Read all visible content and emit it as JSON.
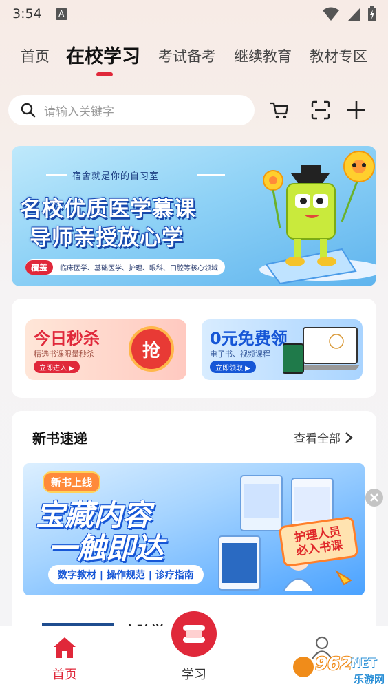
{
  "status_bar": {
    "time": "3:54",
    "indicator": "A"
  },
  "tabs": [
    {
      "label": "首页"
    },
    {
      "label": "在校学习"
    },
    {
      "label": "考试备考"
    },
    {
      "label": "继续教育"
    },
    {
      "label": "教材专区"
    }
  ],
  "active_tab_index": 1,
  "search": {
    "placeholder": "请输入关键字"
  },
  "top_icons": [
    "cart-icon",
    "scan-icon",
    "plus-icon"
  ],
  "banner": {
    "subtitle": "宿舍就是你的自习室",
    "headline_1": "名校优质医学慕课",
    "headline_2": "导师亲授放心学",
    "tag": "覆盖",
    "coverage": "临床医学、基础医学、护理、眼科、口腔等核心领域"
  },
  "promos": [
    {
      "title": "今日秒杀",
      "desc": "精选书课限量秒杀",
      "button": "立即进入 ▶",
      "badge": "抢"
    },
    {
      "title": "0元免费领",
      "desc": "电子书、视频课程",
      "button": "立即领取 ▶"
    }
  ],
  "new_books": {
    "title": "新书速递",
    "view_all": "查看全部",
    "banner": {
      "tag": "新书上线",
      "line1": "宝藏内容",
      "line2": "一触即达",
      "strip": "数字教材 | 操作规范 | 诊疗指南",
      "callout_1": "护理人员",
      "callout_2": "必入书课"
    },
    "peek_text": "实验学"
  },
  "bottom_nav": [
    {
      "label": "首页",
      "icon": "home-icon",
      "active": true
    },
    {
      "label": "学习",
      "icon": "study-logo-icon",
      "active": false
    },
    {
      "label": "",
      "icon": "user-icon",
      "active": false
    }
  ],
  "watermark": {
    "text_1": "962",
    "text_2": "NET",
    "text_3": "乐游网"
  },
  "colors": {
    "accent": "#e0283a",
    "blue": "#1656d6"
  }
}
